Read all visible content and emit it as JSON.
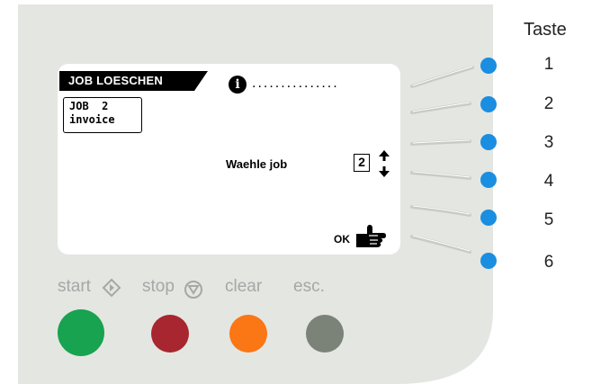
{
  "screen": {
    "title": "JOB LOESCHEN",
    "job_line1": "JOB  2",
    "job_line2": "invoice",
    "info_symbol": "i",
    "info_dots": "...............",
    "select_label": "Waehle job",
    "job_number": "2",
    "ok_label": "OK"
  },
  "side_keys": {
    "heading": "Taste",
    "keys": [
      "1",
      "2",
      "3",
      "4",
      "5",
      "6"
    ],
    "color": "#1a8ee0"
  },
  "buttons": {
    "start": {
      "label": "start",
      "color": "#17a34f"
    },
    "stop": {
      "label": "stop",
      "color": "#a8262f"
    },
    "clear": {
      "label": "clear",
      "color": "#fb7615"
    },
    "esc": {
      "label": "esc.",
      "color": "#7b8379"
    }
  },
  "colors": {
    "panel": "#e4e6e1",
    "lcd": "#ffffff",
    "label_gray": "#a7a7a7"
  }
}
